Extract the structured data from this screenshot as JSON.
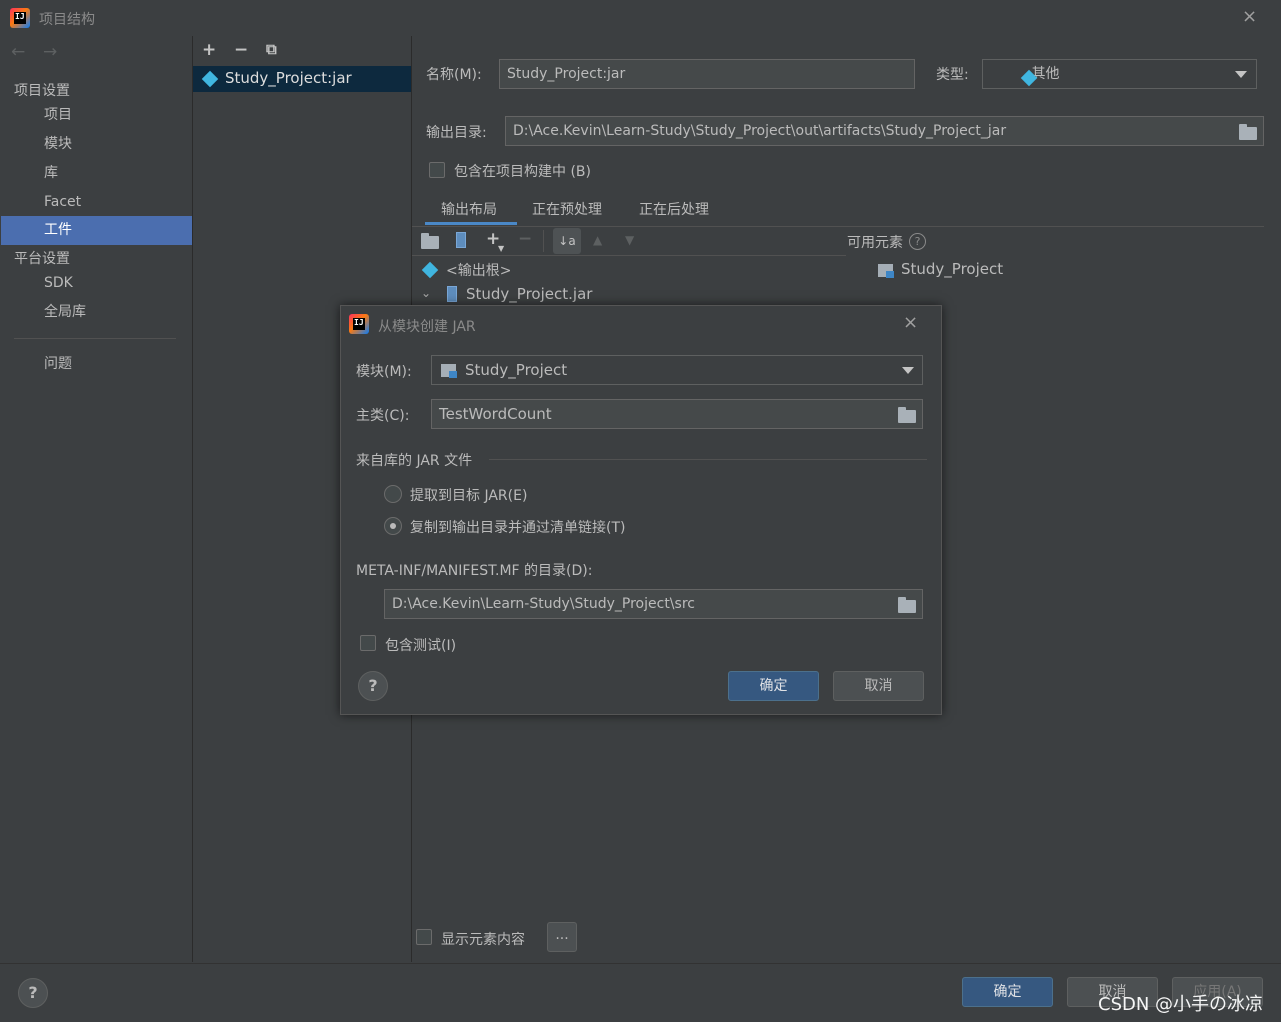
{
  "window": {
    "title": "项目结构",
    "close_icon": "×"
  },
  "nav": {
    "project_settings_header": "项目设置",
    "items": [
      "项目",
      "模块",
      "库",
      "Facet",
      "工件"
    ],
    "platform_settings_header": "平台设置",
    "platform_items": [
      "SDK",
      "全局库"
    ],
    "problems": "问题"
  },
  "artifacts_list": {
    "add_icon": "+",
    "remove_icon": "−",
    "copy_icon": "⧉",
    "selected_item": "Study_Project:jar"
  },
  "artifact": {
    "name_label": "名称(M):",
    "name_value": "Study_Project:jar",
    "type_label": "类型:",
    "type_value": "其他",
    "output_dir_label": "输出目录:",
    "output_dir_value": "D:\\Ace.Kevin\\Learn-Study\\Study_Project\\out\\artifacts\\Study_Project_jar",
    "include_in_build_label": "包含在项目构建中 (B)",
    "include_in_build_checked": false,
    "tabs": [
      "输出布局",
      "正在预处理",
      "正在后处理"
    ],
    "active_tab": "输出布局",
    "available_elements_label": "可用元素",
    "available_elements_help": "?",
    "tree_root": "<输出根>",
    "tree_jar": "Study_Project.jar",
    "available_module": "Study_Project",
    "show_content_label": "显示元素内容",
    "show_content_checked": false,
    "dots_label": "..."
  },
  "dialog": {
    "title": "从模块创建 JAR",
    "module_label": "模块(M):",
    "module_value": "Study_Project",
    "main_class_label": "主类(C):",
    "main_class_value": "TestWordCount",
    "jar_files_section": "来自库的 JAR 文件",
    "radio_extract": "提取到目标 JAR(E)",
    "radio_copy": "复制到输出目录并通过清单链接(T)",
    "selected_radio": "copy",
    "manifest_label": "META-INF/MANIFEST.MF 的目录(D):",
    "manifest_value": "D:\\Ace.Kevin\\Learn-Study\\Study_Project\\src",
    "include_tests_label": "包含测试(I)",
    "include_tests_checked": false,
    "help": "?",
    "ok": "确定",
    "cancel": "取消"
  },
  "footer": {
    "help": "?",
    "ok": "确定",
    "cancel": "取消",
    "apply": "应用(A)",
    "watermark": "CSDN @小手の冰凉"
  },
  "colors": {
    "background": "#3c3f41",
    "selection": "#4b6eaf",
    "primary_button": "#365880",
    "tab_underline": "#4a88c7"
  }
}
